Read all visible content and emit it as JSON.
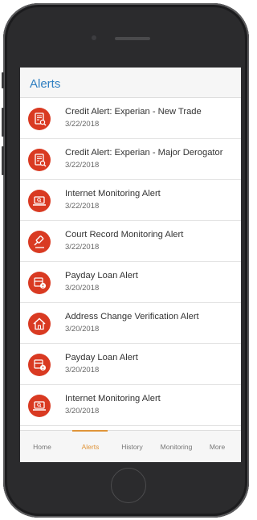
{
  "header": {
    "title": "Alerts"
  },
  "alerts": [
    {
      "title": "Credit Alert: Experian - New Trade",
      "date": "3/22/2018",
      "icon": "document-search-icon"
    },
    {
      "title": "Credit Alert: Experian - Major Derogator",
      "date": "3/22/2018",
      "icon": "document-search-icon"
    },
    {
      "title": "Internet Monitoring Alert",
      "date": "3/22/2018",
      "icon": "laptop-search-icon"
    },
    {
      "title": "Court Record Monitoring Alert",
      "date": "3/22/2018",
      "icon": "gavel-icon"
    },
    {
      "title": "Payday Loan Alert",
      "date": "3/20/2018",
      "icon": "money-alert-icon"
    },
    {
      "title": "Address Change Verification Alert",
      "date": "3/20/2018",
      "icon": "house-icon"
    },
    {
      "title": "Payday Loan Alert",
      "date": "3/20/2018",
      "icon": "money-alert-icon"
    },
    {
      "title": "Internet Monitoring Alert",
      "date": "3/20/2018",
      "icon": "laptop-search-icon"
    }
  ],
  "tabs": [
    {
      "label": "Home",
      "active": false
    },
    {
      "label": "Alerts",
      "active": true
    },
    {
      "label": "History",
      "active": false
    },
    {
      "label": "Monitoring",
      "active": false
    },
    {
      "label": "More",
      "active": false
    }
  ],
  "colors": {
    "accent": "#2f7fc1",
    "alert_red": "#d93a22",
    "active_tab": "#e0953a"
  }
}
